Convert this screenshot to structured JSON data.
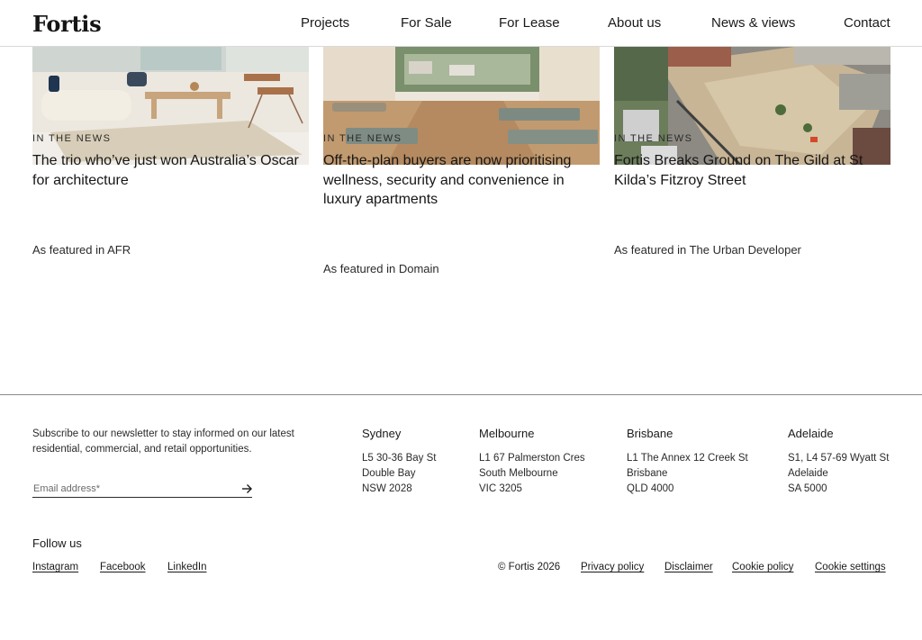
{
  "header": {
    "logo": "Fortis",
    "nav": [
      {
        "label": "Projects"
      },
      {
        "label": "For Sale"
      },
      {
        "label": "For Lease"
      },
      {
        "label": "About us"
      },
      {
        "label": "News & views"
      },
      {
        "label": "Contact"
      }
    ]
  },
  "articles": [
    {
      "kicker": "IN THE NEWS",
      "title": "The trio who’ve just won Australia’s Oscar for architecture",
      "source": "As featured in AFR"
    },
    {
      "kicker": "IN THE NEWS",
      "title": "Off-the-plan buyers are now prioritising wellness, security and convenience in luxury apartments",
      "source": "As featured in Domain"
    },
    {
      "kicker": "IN THE NEWS",
      "title": "Fortis Breaks Ground on The Gild at St Kilda’s Fitzroy Street",
      "source": "As featured in The Urban Developer"
    }
  ],
  "footer": {
    "newsletter_text": "Subscribe to our newsletter to stay informed on our latest residential, commercial, and retail opportunities.",
    "email_placeholder": "Email address*",
    "offices": [
      {
        "city": "Sydney",
        "lines": [
          "L5 30-36 Bay St",
          "Double Bay",
          "NSW 2028"
        ]
      },
      {
        "city": "Melbourne",
        "lines": [
          "L1 67 Palmerston Cres",
          "South Melbourne",
          "VIC 3205"
        ]
      },
      {
        "city": "Brisbane",
        "lines": [
          "L1 The Annex 12 Creek St",
          "Brisbane",
          "QLD 4000"
        ]
      },
      {
        "city": "Adelaide",
        "lines": [
          "S1, L4 57-69 Wyatt St",
          "Adelaide",
          "SA 5000"
        ]
      }
    ],
    "follow_label": "Follow us",
    "social": [
      "Instagram",
      "Facebook",
      "LinkedIn"
    ],
    "copyright": "© Fortis 2026",
    "legal": [
      "Privacy policy",
      "Disclaimer",
      "Cookie policy",
      "Cookie settings"
    ]
  },
  "colors": {
    "text": "#1c1c1c",
    "rule": "#8a8a8a",
    "background": "#ffffff"
  }
}
